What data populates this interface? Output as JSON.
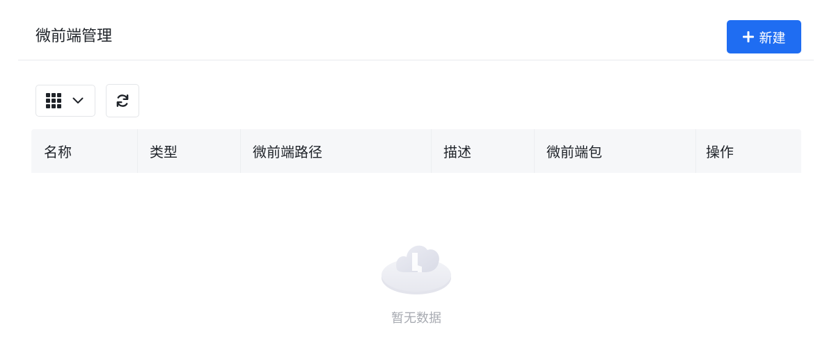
{
  "header": {
    "title": "微前端管理",
    "new_button_label": "新建"
  },
  "toolbar": {
    "view_toggle_icon": "grid-icon",
    "view_toggle_caret": "chevron-down-icon",
    "refresh_icon": "refresh-icon"
  },
  "table": {
    "columns": [
      "名称",
      "类型",
      "微前端路径",
      "描述",
      "微前端包",
      "操作"
    ],
    "rows": []
  },
  "empty_state": {
    "icon": "empty-cloud-icon",
    "text": "暂无数据"
  },
  "colors": {
    "accent": "#1f6df2",
    "header_bg": "#f6f7f9",
    "muted_text": "#a8abb2"
  }
}
